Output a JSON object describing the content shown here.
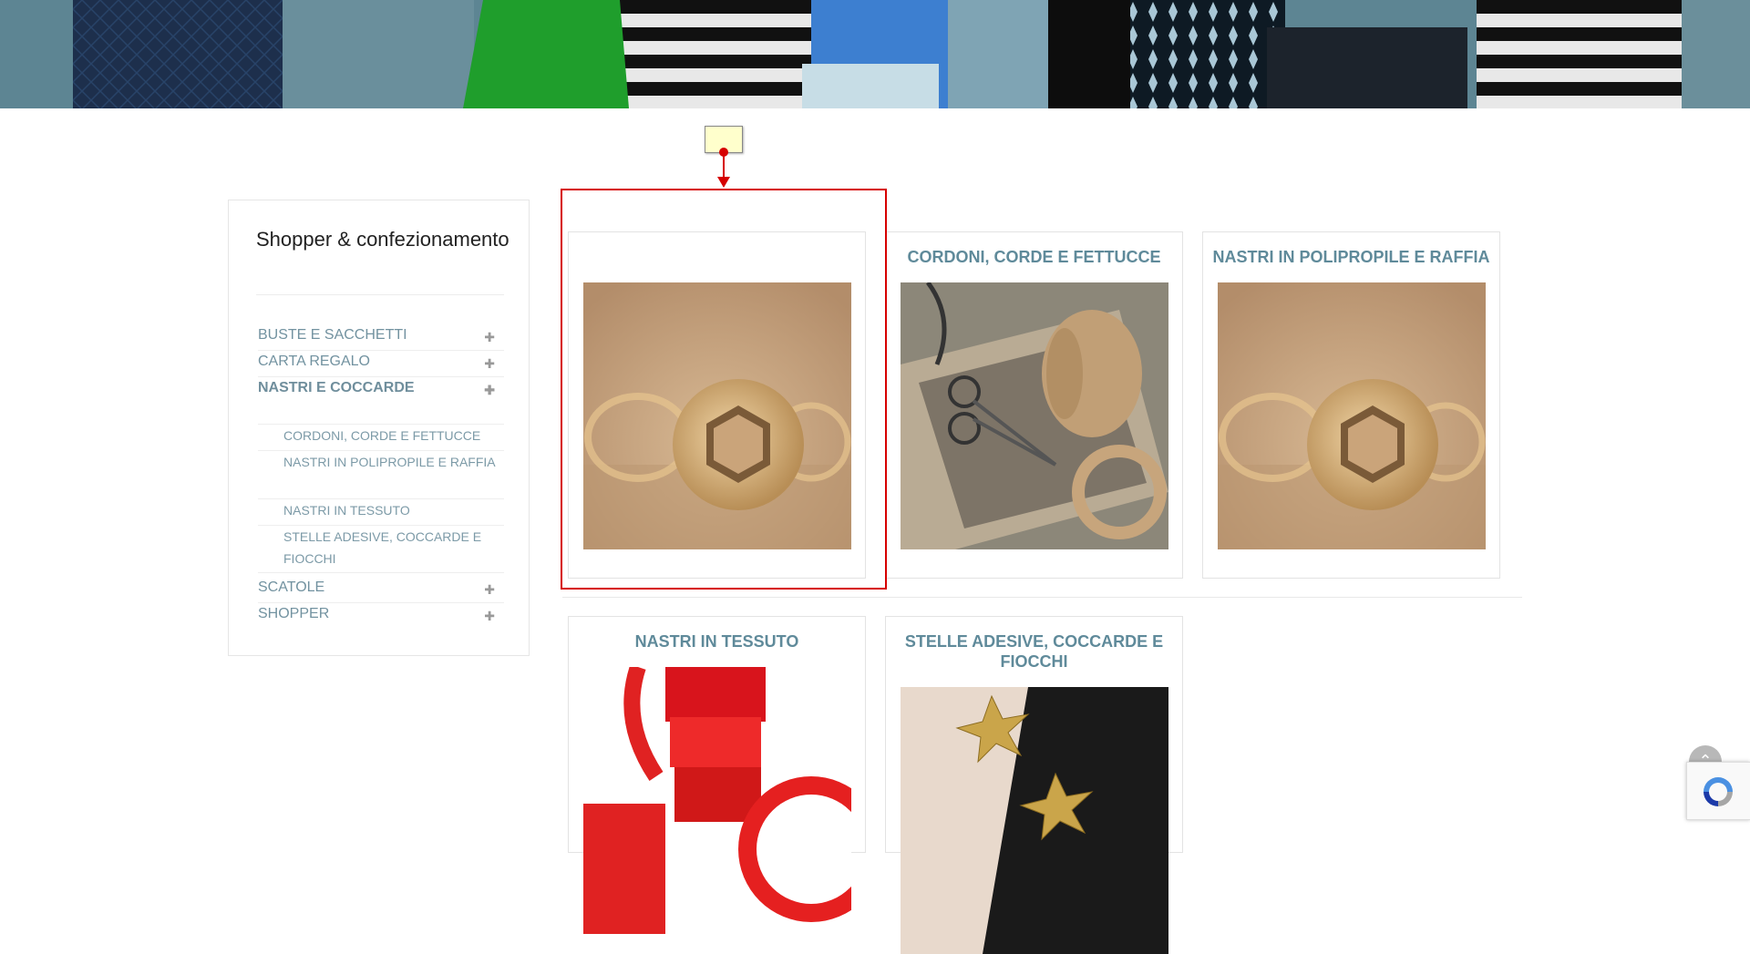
{
  "sidebar": {
    "title": "Shopper & confezionamento",
    "items": [
      {
        "label": "BUSTE E SACCHETTI",
        "expand_icon": "plus-icon"
      },
      {
        "label": "CARTA REGALO",
        "expand_icon": "plus-icon"
      },
      {
        "label": "NASTRI E COCCARDE",
        "expand_icon": "plus-icon",
        "active": true
      },
      {
        "label": "SCATOLE",
        "expand_icon": "plus-icon"
      },
      {
        "label": "SHOPPER",
        "expand_icon": "plus-icon"
      }
    ],
    "subitems": [
      {
        "label": "CORDONI, CORDE E FETTUCCE"
      },
      {
        "label": "NASTRI IN POLIPROPILE E RAFFIA"
      },
      {
        "label": "NASTRI IN TESSUTO"
      },
      {
        "label": "STELLE ADESIVE, COCCARDE E FIOCCHI"
      }
    ]
  },
  "cards": [
    {
      "title": "",
      "image": "raffia-spool-image"
    },
    {
      "title": "CORDONI, CORDE E FETTUCCE",
      "image": "twine-scissors-image"
    },
    {
      "title": "NASTRI IN POLIPROPILE E RAFFIA",
      "image": "raffia-spool-image"
    },
    {
      "title": "NASTRI IN TESSUTO",
      "image": "red-ribbons-image"
    },
    {
      "title": "STELLE ADESIVE, COCCARDE E FIOCCHI",
      "image": "gold-bows-image"
    }
  ],
  "colors": {
    "accent": "#5f8a9a",
    "highlight": "#d60000",
    "hero": "#5b8391"
  },
  "icons": {
    "scroll_top": "chevron-up-icon",
    "recaptcha": "recaptcha-icon"
  }
}
